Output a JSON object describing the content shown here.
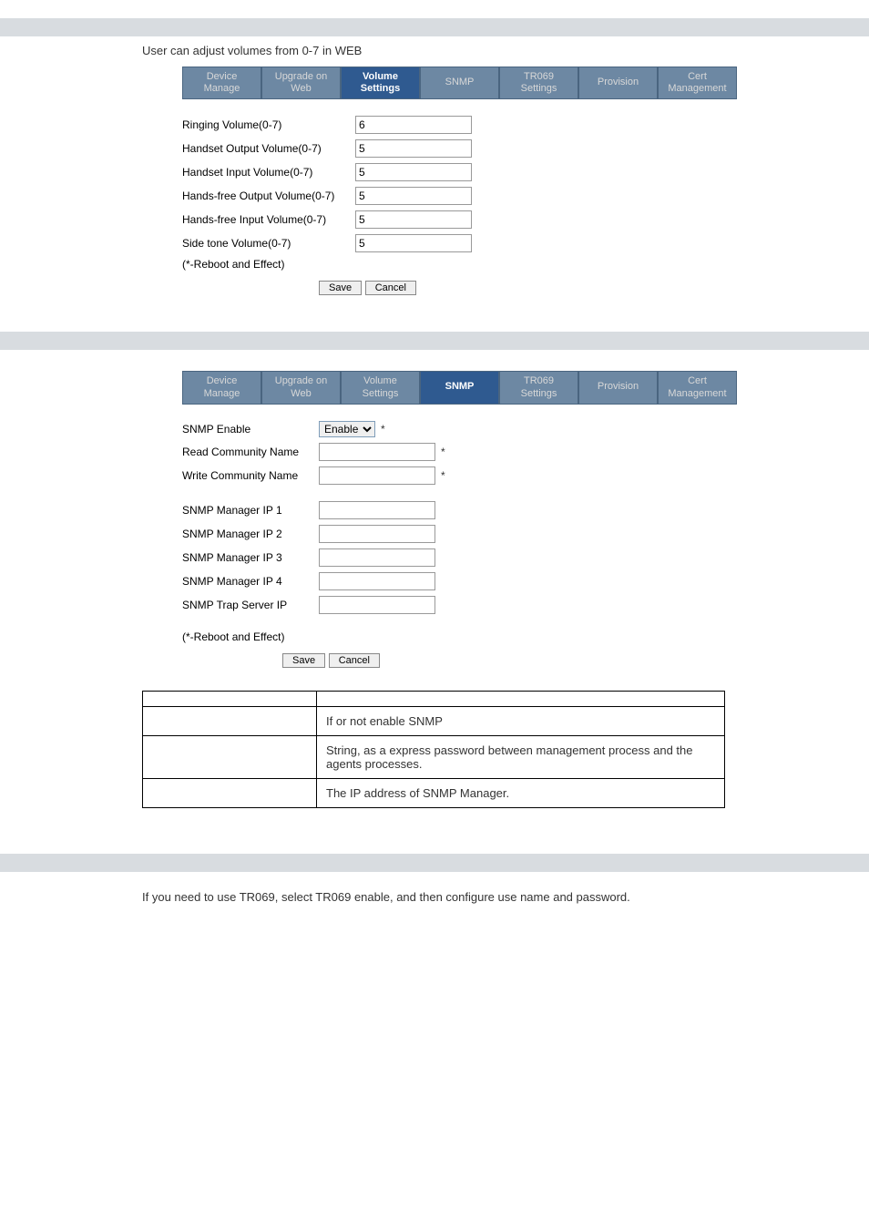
{
  "volume": {
    "intro": "User can adjust volumes from 0-7 in WEB",
    "tabs": {
      "device_manage": "Device\nManage",
      "upgrade_web": "Upgrade on\nWeb",
      "volume_settings": "Volume\nSettings",
      "snmp": "SNMP",
      "tr069_settings": "TR069\nSettings",
      "provision": "Provision",
      "cert_management": "Cert\nManagement"
    },
    "labels": {
      "ringing": "Ringing Volume(0-7)",
      "handset_output": "Handset Output Volume(0-7)",
      "handset_input": "Handset Input Volume(0-7)",
      "handsfree_output": "Hands-free Output Volume(0-7)",
      "handsfree_input": "Hands-free Input Volume(0-7)",
      "side_tone": "Side tone Volume(0-7)",
      "reboot_note": "(*-Reboot and Effect)"
    },
    "values": {
      "ringing": "6",
      "handset_output": "5",
      "handset_input": "5",
      "handsfree_output": "5",
      "handsfree_input": "5",
      "side_tone": "5"
    },
    "buttons": {
      "save": "Save",
      "cancel": "Cancel"
    }
  },
  "snmp": {
    "tabs": {
      "device_manage": "Device\nManage",
      "upgrade_web": "Upgrade on\nWeb",
      "volume_settings": "Volume\nSettings",
      "snmp": "SNMP",
      "tr069_settings": "TR069\nSettings",
      "provision": "Provision",
      "cert_management": "Cert\nManagement"
    },
    "labels": {
      "enable": "SNMP Enable",
      "read_community": "Read Community Name",
      "write_community": "Write Community Name",
      "mgr_ip1": "SNMP Manager IP 1",
      "mgr_ip2": "SNMP Manager IP 2",
      "mgr_ip3": "SNMP Manager IP 3",
      "mgr_ip4": "SNMP Manager IP 4",
      "trap_server": "SNMP Trap Server IP",
      "reboot_note": "(*-Reboot and Effect)"
    },
    "values": {
      "enable_option": "Enable",
      "read_community": "",
      "write_community": "",
      "mgr_ip1": "",
      "mgr_ip2": "",
      "mgr_ip3": "",
      "mgr_ip4": "",
      "trap_server": ""
    },
    "buttons": {
      "save": "Save",
      "cancel": "Cancel"
    },
    "desc": {
      "row1": "If or not enable SNMP",
      "row2": "String, as a express password between management process and the agents processes.",
      "row3": "The IP address of SNMP Manager."
    }
  },
  "tr069": {
    "intro": "If you need to use TR069, select TR069 enable, and then configure use name and password."
  },
  "asterisk": "*"
}
